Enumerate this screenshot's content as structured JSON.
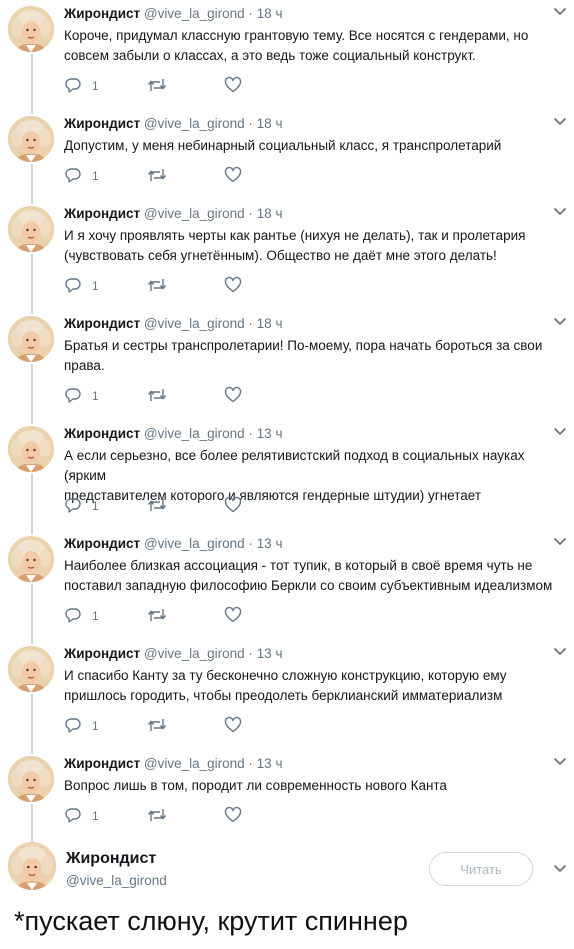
{
  "tweets": [
    {
      "name": "Жирондист",
      "handle": "@vive_la_girond",
      "sep": " · ",
      "time": "18 ч",
      "lines": [
        "Короче, придумал классную грантовую тему. Все носятся с гендерами, но",
        "совсем забыли о классах, а это ведь тоже социальный конструкт."
      ],
      "reply_count": "1"
    },
    {
      "name": "Жирондист",
      "handle": "@vive_la_girond",
      "sep": " · ",
      "time": "18 ч",
      "lines": [
        "Допустим, у меня небинарный социальный класс, я транспролетарий"
      ],
      "reply_count": "1"
    },
    {
      "name": "Жирондист",
      "handle": "@vive_la_girond",
      "sep": " · ",
      "time": "18 ч",
      "lines": [
        "И я хочу проявлять черты как рантье (нихуя не делать), так и пролетария",
        "(чувствовать себя угнетённым). Общество не даёт мне этого делать!"
      ],
      "reply_count": "1"
    },
    {
      "name": "Жирондист",
      "handle": "@vive_la_girond",
      "sep": " · ",
      "time": "18 ч",
      "lines": [
        "Братья и сестры транспролетарии! По-моему, пора начать бороться за свои",
        "права."
      ],
      "reply_count": "1"
    },
    {
      "name": "Жирондист",
      "handle": "@vive_la_girond",
      "sep": " · ",
      "time": "13 ч",
      "lines": [
        "А если серьезно, все более релятивистский подход в социальных науках (ярким",
        "представителем которого и являются гендерные штудии) угнетает"
      ],
      "reply_count": "1"
    },
    {
      "name": "Жирондист",
      "handle": "@vive_la_girond",
      "sep": " · ",
      "time": "13 ч",
      "lines": [
        "Наиболее близкая ассоциация - тот тупик, в который в своё время чуть не",
        "поставил западную философию Беркли со своим субъективным идеализмом"
      ],
      "reply_count": "1"
    },
    {
      "name": "Жирондист",
      "handle": "@vive_la_girond",
      "sep": " · ",
      "time": "13 ч",
      "lines": [
        "И спасибо Канту за ту бесконечно сложную конструкцию, которую ему",
        "пришлось городить, чтобы преодолеть берклианский имматериализм"
      ],
      "reply_count": "1"
    },
    {
      "name": "Жирондист",
      "handle": "@vive_la_girond",
      "sep": " · ",
      "time": "13 ч",
      "lines": [
        "Вопрос лишь в том, породит ли современность нового Канта"
      ],
      "reply_count": "1"
    }
  ],
  "profile": {
    "name": "Жирондист",
    "handle": "@vive_la_girond",
    "follow_label": "Читать"
  },
  "caption": "*пускает слюну, крутит спиннер",
  "icons": {
    "reply": "reply-icon",
    "retweet": "retweet-icon",
    "like": "heart-icon",
    "caret": "chevron-down-icon"
  },
  "colors": {
    "thread_line": "#ccd6dd",
    "muted": "#657786",
    "text": "#14171a"
  }
}
